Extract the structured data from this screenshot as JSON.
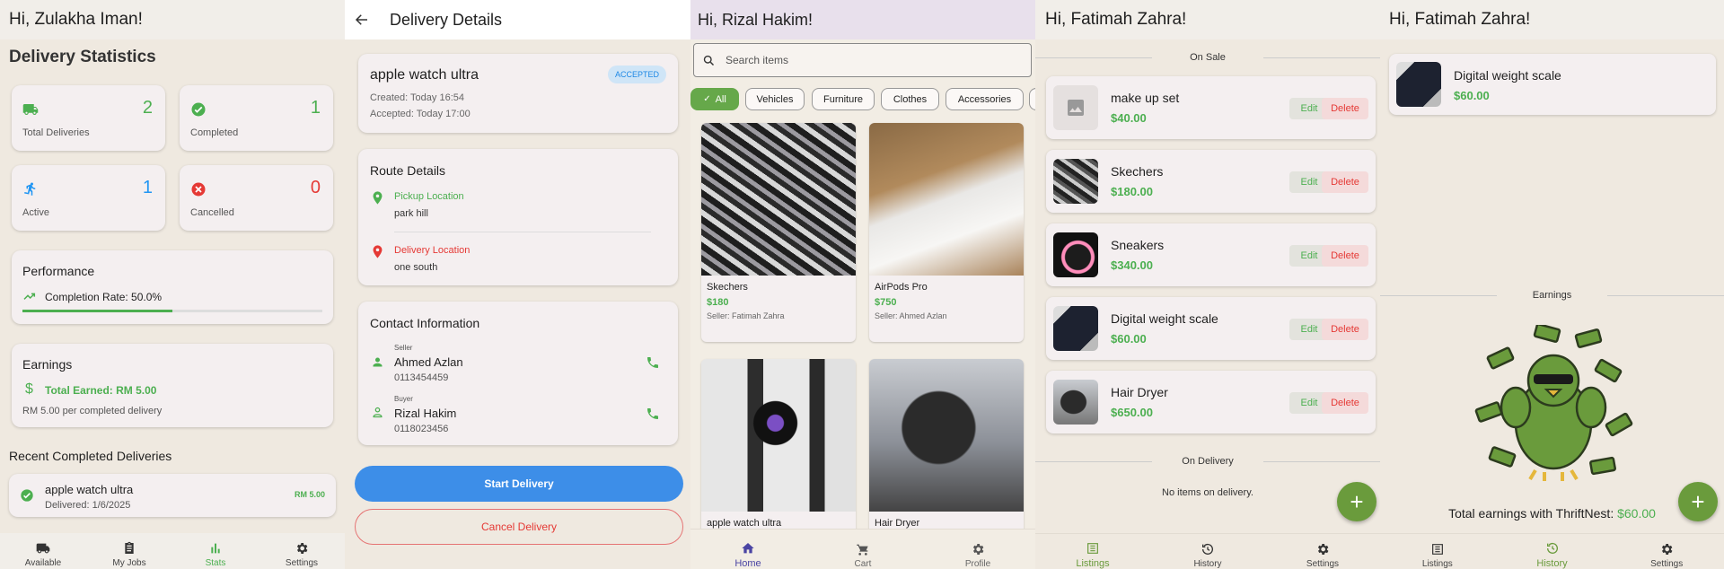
{
  "s1": {
    "header": "Hi, Zulakha Iman!",
    "title": "Delivery Statistics",
    "stats": [
      {
        "value": "2",
        "label": "Total Deliveries",
        "color": "#4caf50"
      },
      {
        "value": "1",
        "label": "Completed",
        "color": "#4caf50"
      },
      {
        "value": "1",
        "label": "Active",
        "color": "#2196f3"
      },
      {
        "value": "0",
        "label": "Cancelled",
        "color": "#e53935"
      }
    ],
    "performance": {
      "title": "Performance",
      "text": "Completion Rate: 50.0%",
      "rate": 0.5
    },
    "earnings": {
      "title": "Earnings",
      "total": "Total Earned: RM 5.00",
      "note": "RM 5.00 per completed delivery"
    },
    "recent_title": "Recent Completed Deliveries",
    "recent": {
      "name": "apple watch ultra",
      "date": "Delivered: 1/6/2025",
      "amount": "RM 5.00"
    },
    "nav": [
      "Available",
      "My Jobs",
      "Stats",
      "Settings"
    ]
  },
  "s2": {
    "header": "Delivery Details",
    "item": "apple watch ultra",
    "badge": "ACCEPTED",
    "created": "Created: Today 16:54",
    "accepted": "Accepted: Today 17:00",
    "route_title": "Route Details",
    "pickup_label": "Pickup Location",
    "pickup": "park hill",
    "delivery_label": "Delivery Location",
    "delivery": "one south",
    "contact_title": "Contact Information",
    "seller_role": "Seller",
    "seller_name": "Ahmed Azlan",
    "seller_phone": "0113454459",
    "buyer_role": "Buyer",
    "buyer_name": "Rizal Hakim",
    "buyer_phone": "0118023456",
    "start_btn": "Start Delivery",
    "cancel_btn": "Cancel Delivery"
  },
  "s3": {
    "header": "Hi, Rizal Hakim!",
    "search_placeholder": "Search items",
    "chips": [
      "All",
      "Vehicles",
      "Furniture",
      "Clothes",
      "Accessories"
    ],
    "products": [
      {
        "title": "Skechers",
        "price": "$180",
        "seller": "Seller: Fatimah Zahra"
      },
      {
        "title": "AirPods Pro",
        "price": "$750",
        "seller": "Seller: Ahmed Azlan"
      },
      {
        "title": "apple watch ultra"
      },
      {
        "title": "Hair Dryer"
      }
    ],
    "nav": [
      "Home",
      "Cart",
      "Profile"
    ]
  },
  "s4": {
    "header": "Hi, Fatimah Zahra!",
    "on_sale": "On Sale",
    "listings": [
      {
        "name": "make up set",
        "price": "$40.00"
      },
      {
        "name": "Skechers",
        "price": "$180.00"
      },
      {
        "name": "Sneakers",
        "price": "$340.00"
      },
      {
        "name": "Digital weight scale",
        "price": "$60.00"
      },
      {
        "name": "Hair Dryer",
        "price": "$650.00"
      }
    ],
    "edit": "Edit",
    "delete": "Delete",
    "on_delivery": "On Delivery",
    "no_items": "No items on delivery.",
    "nav": [
      "Listings",
      "History",
      "Settings"
    ]
  },
  "s5": {
    "header": "Hi, Fatimah Zahra!",
    "item_name": "Digital weight scale",
    "item_price": "$60.00",
    "earnings_label": "Earnings",
    "total_label": "Total earnings with ThriftNest:",
    "total_value": "$60.00",
    "nav": [
      "Listings",
      "History",
      "Settings"
    ]
  }
}
